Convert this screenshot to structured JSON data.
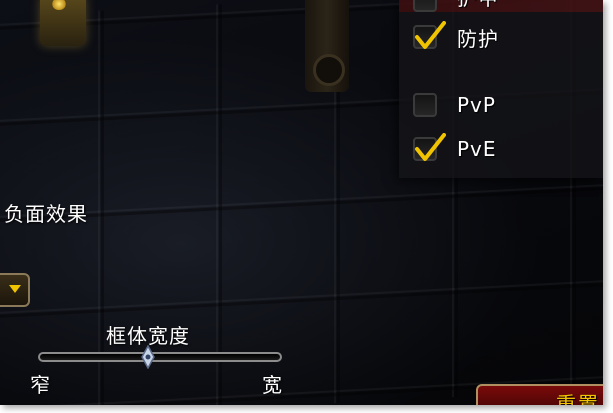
{
  "options": {
    "partial_label": "护甲",
    "defense": {
      "label": "防护",
      "checked": true
    },
    "pvp": {
      "label": "PvP",
      "checked": false
    },
    "pve": {
      "label": "PvE",
      "checked": true
    }
  },
  "debuffs": {
    "label": "负面效果"
  },
  "frame_width": {
    "label": "框体宽度",
    "min_label": "窄",
    "max_label": "宽",
    "value_fraction": 0.45
  },
  "reset_button": {
    "label": "重置"
  },
  "colors": {
    "check_yellow": "#f0c400",
    "button_red": "#6a0808",
    "text_white": "#ffffff"
  }
}
